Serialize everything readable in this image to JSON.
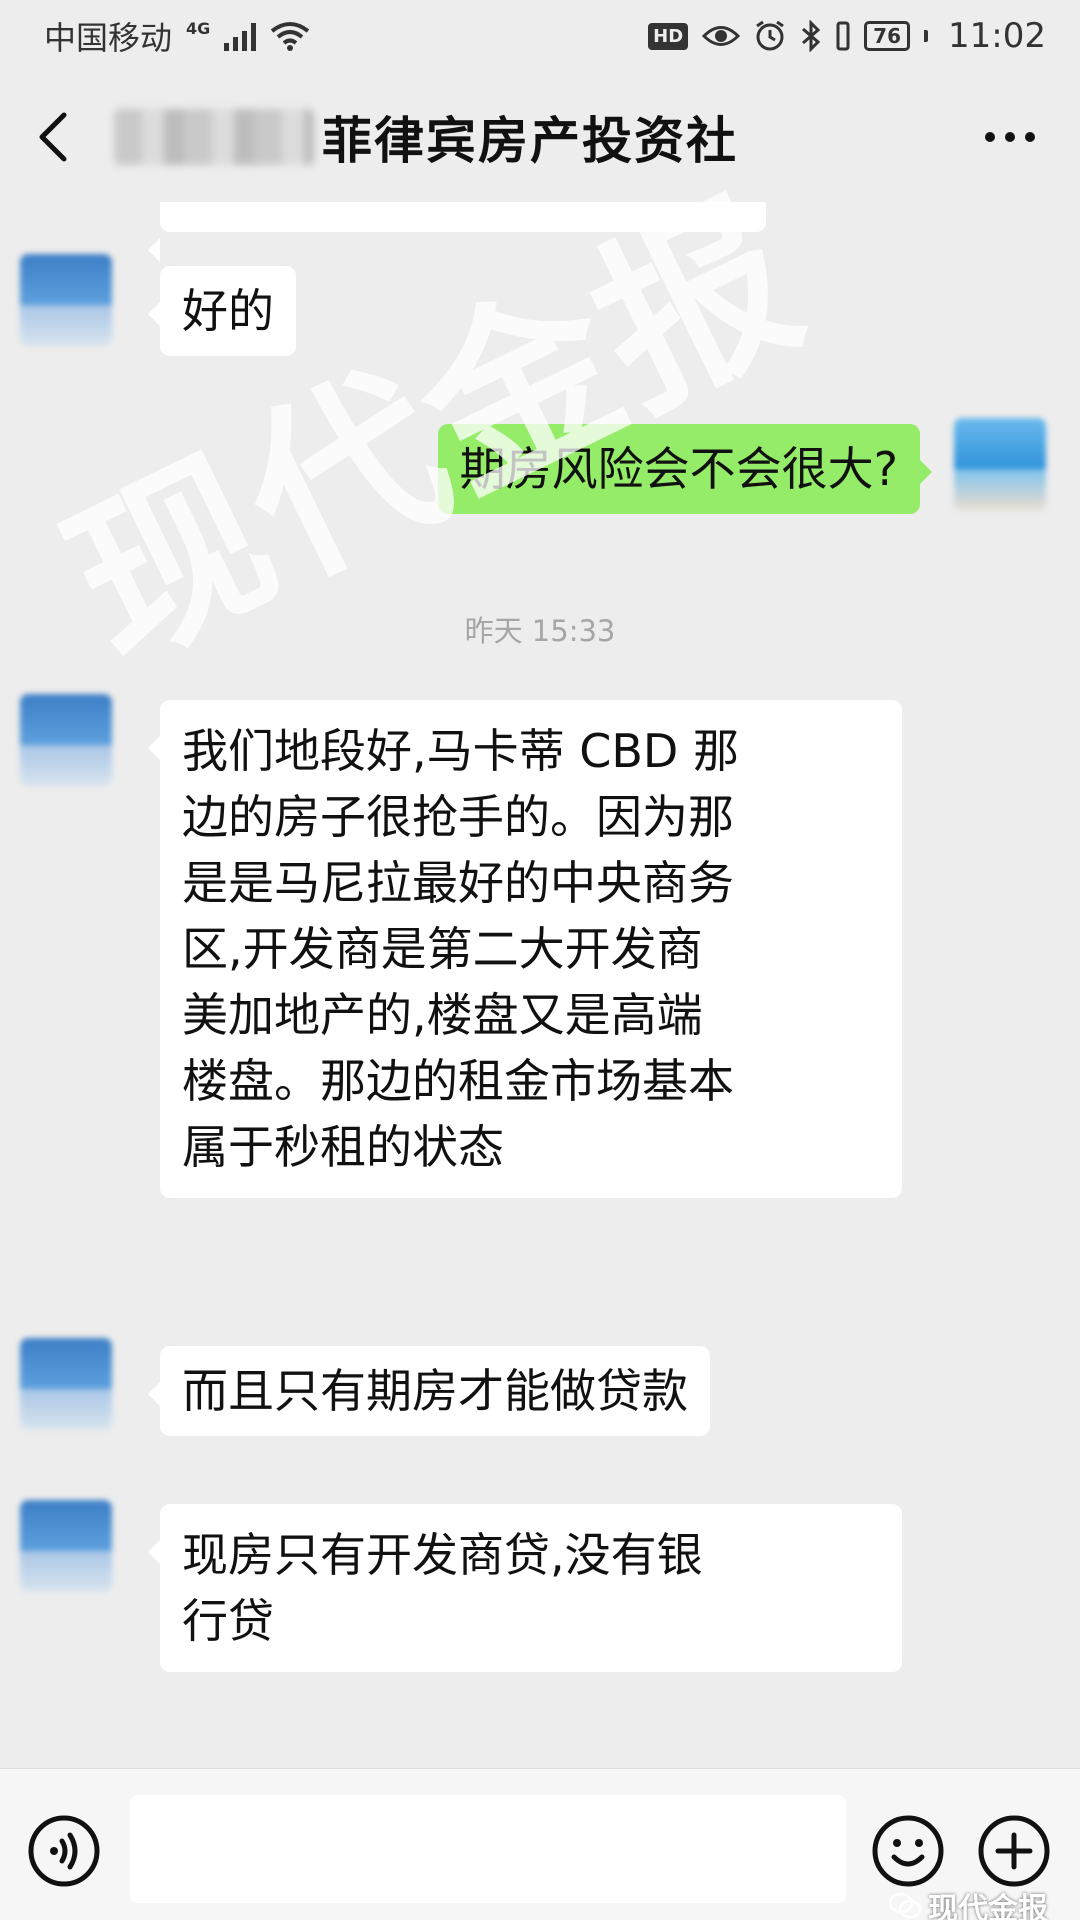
{
  "status_bar": {
    "carrier": "中国移动",
    "network": "4G",
    "battery": "76",
    "time": "11:02",
    "hd": "HD"
  },
  "header": {
    "title": "菲律宾房产投资社"
  },
  "messages": [
    {
      "side": "left",
      "text": "好的"
    },
    {
      "side": "right",
      "text": "期房风险会不会很大?"
    },
    {
      "side": "left",
      "text": "我们地段好,马卡蒂CBD那边的房子很抢手的。因为那是是马尼拉最好的中央商务区,开发商是第二大开发商美加地产的,楼盘又是高端楼盘。那边的租金市场基本属于秒租的状态"
    },
    {
      "side": "left",
      "text": "而且只有期房才能做贷款"
    },
    {
      "side": "left",
      "text": "现房只有开发商贷,没有银行贷"
    }
  ],
  "timestamp": "昨天 15:33",
  "message_lines": {
    "m3": [
      "我们地段好,马卡蒂 CBD 那",
      "边的房子很抢手的。因为那",
      "是是马尼拉最好的中央商务",
      "区,开发商是第二大开发商",
      "美加地产的,楼盘又是高端",
      "楼盘。那边的租金市场基本",
      "属于秒租的状态"
    ],
    "m5": [
      "现房只有开发商贷,没有银",
      "行贷"
    ]
  },
  "watermark": "现代金报",
  "source_watermark": "现代金报",
  "input": {
    "value": "",
    "placeholder": ""
  },
  "colors": {
    "background": "#ededed",
    "self_bubble": "#95ec69",
    "other_bubble": "#ffffff",
    "timestamp_text": "#a6a6a6"
  },
  "icons": [
    "back-icon",
    "more-icon",
    "voice-icon",
    "emoji-icon",
    "plus-icon",
    "wechat-icon"
  ]
}
